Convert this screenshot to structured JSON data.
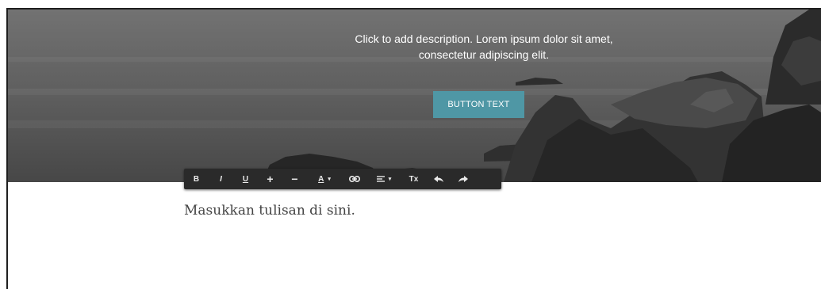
{
  "hero": {
    "description_line1": "Click to add description. Lorem ipsum dolor sit amet,",
    "description_line2": "consectetur adipiscing elit.",
    "button_label": "BUTTON TEXT",
    "button_color": "#4f97a5"
  },
  "toolbar": {
    "bold": "B",
    "italic": "I",
    "underline": "U",
    "increase_size": "+",
    "decrease_size": "−",
    "text_color": "A",
    "text_color_caret": "▾",
    "link_icon": "link-icon",
    "align_icon": "align-icon",
    "align_caret": "▾",
    "clear_format": "Tx",
    "undo_icon": "undo-icon",
    "redo_icon": "redo-icon"
  },
  "content": {
    "placeholder_text": "Masukkan tulisan di sini."
  }
}
